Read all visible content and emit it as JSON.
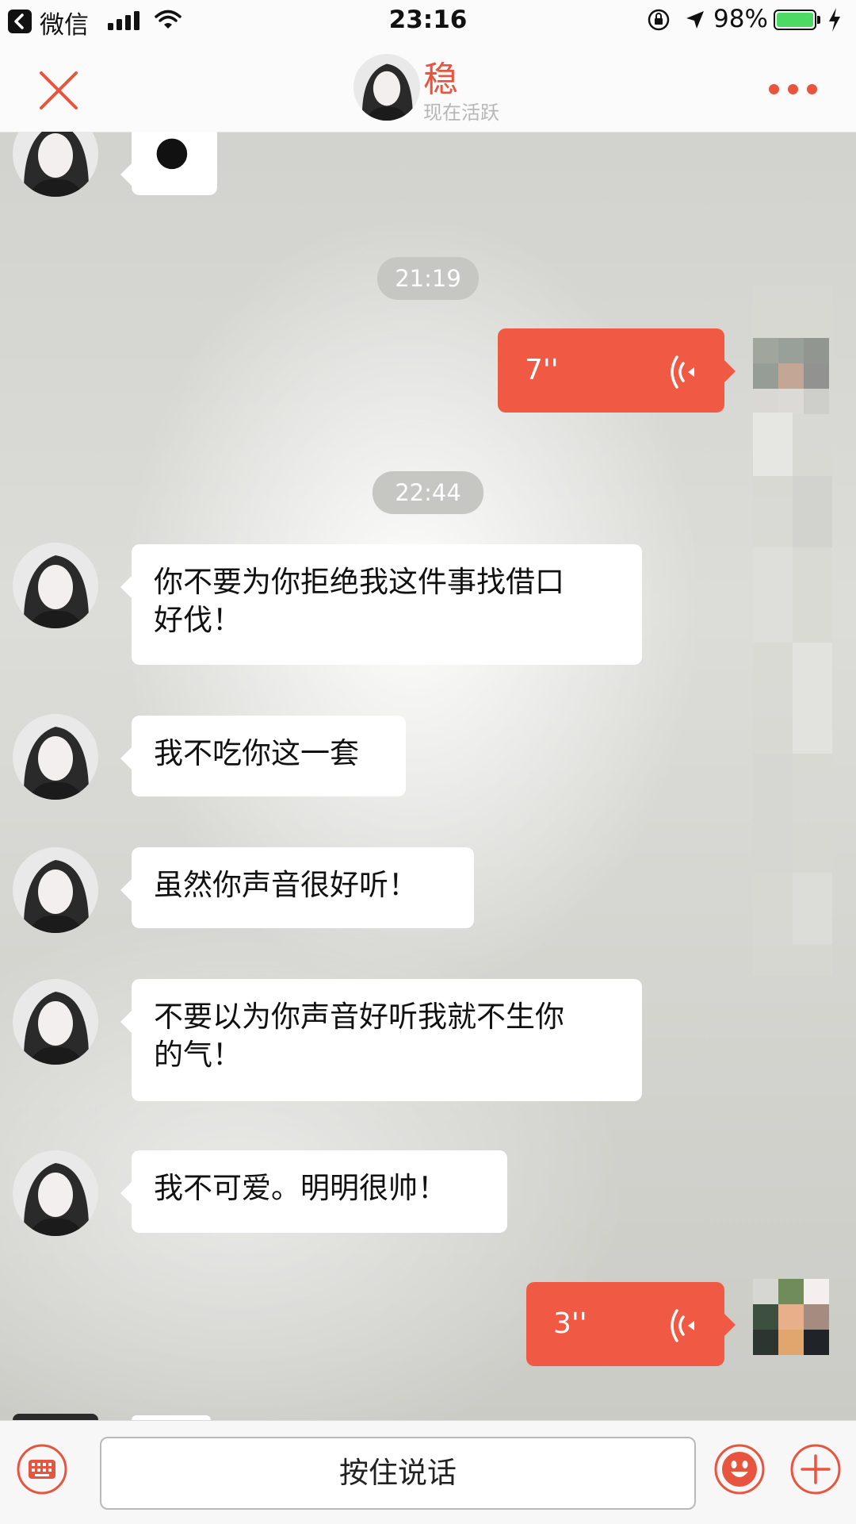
{
  "status_bar": {
    "back_app": "微信",
    "time": "23:16",
    "battery_percent": "98%",
    "battery_level": 0.98
  },
  "nav": {
    "contact_name": "稳",
    "contact_status": "现在活跃",
    "accent_color": "#e8553e"
  },
  "messages": {
    "top_partial_emoji": "🌑",
    "time_1": "21:19",
    "voice_1_duration": "7''",
    "time_2": "22:44",
    "msg_1": "你不要为你拒绝我这件事找借口好伐！",
    "msg_1_line1": "你不要为你拒绝我这件事找借口",
    "msg_1_line2": "好伐！",
    "msg_2": "我不吃你这一套",
    "msg_3": "虽然你声音很好听！",
    "msg_4_line1": "不要以为你声音好听我就不生你",
    "msg_4_line2": "的气！",
    "msg_5": "我不可爱。明明很帅！",
    "voice_2_duration": "3''"
  },
  "input_bar": {
    "hold_to_talk": "按住说话"
  },
  "icons": {
    "close": "close-icon",
    "more": "more-icon",
    "keyboard": "keyboard-icon",
    "emoji": "emoji-icon",
    "plus": "plus-icon",
    "voice_wave": "voice-wave-icon"
  }
}
